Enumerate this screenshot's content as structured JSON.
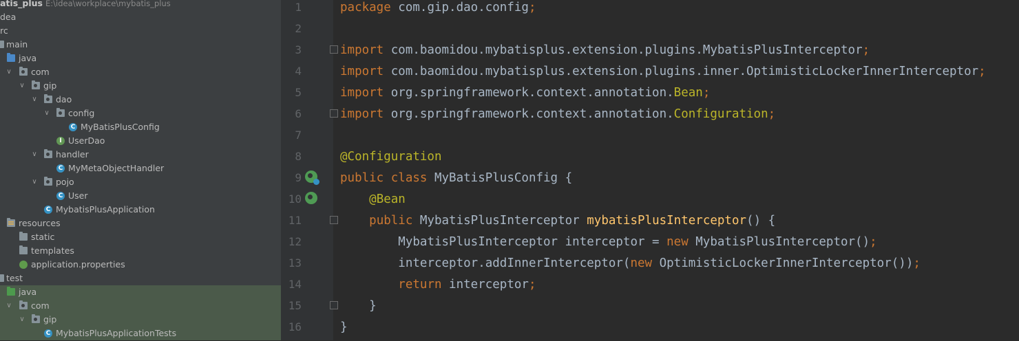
{
  "project": {
    "name": "atis_plus",
    "path": "E:\\idea\\workplace\\mybatis_plus"
  },
  "tree": {
    "idea": "dea",
    "src": "rc",
    "main": "main",
    "java": "java",
    "com": "com",
    "gip": "gip",
    "dao": "dao",
    "config": "config",
    "mybatis_plus_config": "MyBatisPlusConfig",
    "user_dao": "UserDao",
    "handler": "handler",
    "my_meta_object_handler": "MyMetaObjectHandler",
    "pojo": "pojo",
    "user": "User",
    "mybatis_plus_application": "MybatisPlusApplication",
    "resources": "resources",
    "static": "static",
    "templates": "templates",
    "application_properties": "application.properties",
    "test": "test",
    "test_java": "java",
    "test_com": "com",
    "test_gip": "gip",
    "mybatis_plus_application_tests": "MybatisPlusApplicationTests"
  },
  "editor": {
    "line_numbers": [
      "1",
      "2",
      "3",
      "4",
      "5",
      "6",
      "7",
      "8",
      "9",
      "10",
      "11",
      "12",
      "13",
      "14",
      "15",
      "16"
    ],
    "l1": {
      "kw": "package",
      "rest": " com.gip.dao.config",
      "semi": ";"
    },
    "l3": {
      "kw": "import",
      "path": " com.baomidou.mybatisplus.extension.plugins.",
      "cls": "MybatisPlusInterceptor",
      "semi": ";"
    },
    "l4": {
      "kw": "import",
      "path": " com.baomidou.mybatisplus.extension.plugins.inner.",
      "cls": "OptimisticLockerInnerInterceptor",
      "semi": ";"
    },
    "l5": {
      "kw": "import",
      "path": " org.springframework.context.annotation.",
      "cls": "Bean",
      "semi": ";"
    },
    "l6": {
      "kw": "import",
      "path": " org.springframework.context.annotation.",
      "cls": "Configuration",
      "semi": ";"
    },
    "l8": {
      "annotation": "@Configuration"
    },
    "l9": {
      "kw1": "public",
      "kw2": " class",
      "rest": " MyBatisPlusConfig {"
    },
    "l10": {
      "indent": "    ",
      "annotation": "@Bean"
    },
    "l11": {
      "indent": "    ",
      "kw": "public",
      "type": " MybatisPlusInterceptor ",
      "method": "mybatisPlusInterceptor",
      "rest": "() {"
    },
    "l12": {
      "indent": "        ",
      "pre": "MybatisPlusInterceptor interceptor = ",
      "kw": "new",
      "post": " MybatisPlusInterceptor()",
      "semi": ";"
    },
    "l13": {
      "indent": "        ",
      "pre": "interceptor.addInnerInterceptor(",
      "kw": "new",
      "post": " OptimisticLockerInnerInterceptor())",
      "semi": ";"
    },
    "l14": {
      "indent": "        ",
      "kw": "return",
      "rest": " interceptor",
      "semi": ";"
    },
    "l15": {
      "text": "    }"
    },
    "l16": {
      "text": "}"
    }
  },
  "colors": {
    "tree_bg": "#3c3f41",
    "editor_bg": "#2b2b2b",
    "keyword": "#cc7832",
    "annotation": "#bbb529",
    "method": "#ffc66d",
    "text": "#a9b7c6"
  }
}
